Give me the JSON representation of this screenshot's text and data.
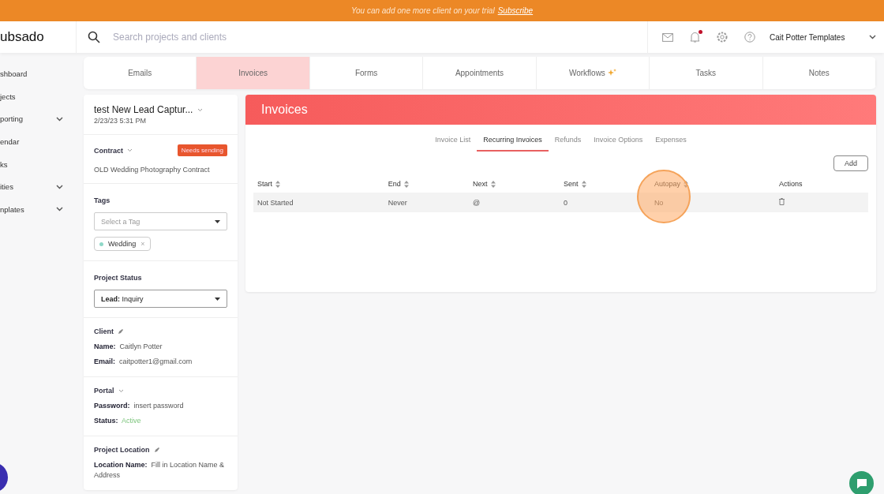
{
  "banner": {
    "text": "You can add one more client on your trial",
    "link": "Subscribe"
  },
  "header": {
    "logo": "ubsado",
    "search": {
      "placeholder": "Search projects and clients"
    },
    "notification_dot": true,
    "account": "Cait Potter Templates"
  },
  "sidebar": {
    "items": [
      {
        "label": "shboard",
        "expandable": false
      },
      {
        "label": "jects",
        "expandable": false
      },
      {
        "label": "porting",
        "expandable": true
      },
      {
        "label": "endar",
        "expandable": false
      },
      {
        "label": "ks",
        "expandable": false
      },
      {
        "label": "ities",
        "expandable": true
      },
      {
        "label": "nplates",
        "expandable": true
      }
    ]
  },
  "tabs": [
    {
      "label": "Emails",
      "selected": false,
      "sparkle": false
    },
    {
      "label": "Invoices",
      "selected": true,
      "sparkle": false
    },
    {
      "label": "Forms",
      "selected": false,
      "sparkle": false
    },
    {
      "label": "Appointments",
      "selected": false,
      "sparkle": false
    },
    {
      "label": "Workflows",
      "selected": false,
      "sparkle": true
    },
    {
      "label": "Tasks",
      "selected": false,
      "sparkle": false
    },
    {
      "label": "Notes",
      "selected": false,
      "sparkle": false
    }
  ],
  "project": {
    "title": "test New Lead Captur...",
    "date": "2/23/23 5:31 PM",
    "contract": {
      "heading": "Contract",
      "badge": "Needs sending",
      "name": "OLD Wedding Photography Contract"
    },
    "tags": {
      "heading": "Tags",
      "placeholder": "Select a Tag",
      "items": [
        {
          "label": "Wedding",
          "color": "#8fd8c8",
          "remove": "×"
        }
      ]
    },
    "status": {
      "heading": "Project Status",
      "label": "Lead:",
      "value": "Inquiry"
    },
    "client": {
      "heading": "Client",
      "fields": [
        {
          "label": "Name:",
          "value": "Caitlyn Potter"
        },
        {
          "label": "Email:",
          "value": "caitpotter1@gmail.com"
        }
      ]
    },
    "portal": {
      "heading": "Portal",
      "fields": [
        {
          "label": "Password:",
          "value": "insert password",
          "kind": "plain"
        },
        {
          "label": "Status:",
          "value": "Active",
          "kind": "status"
        }
      ]
    },
    "location": {
      "heading": "Project Location",
      "fields": [
        {
          "label": "Location Name:",
          "value": "Fill in Location Name & Address"
        }
      ]
    }
  },
  "invoices": {
    "title": "Invoices",
    "subtabs": [
      {
        "label": "Invoice List",
        "selected": false
      },
      {
        "label": "Recurring Invoices",
        "selected": true
      },
      {
        "label": "Refunds",
        "selected": false
      },
      {
        "label": "Invoice Options",
        "selected": false
      },
      {
        "label": "Expenses",
        "selected": false
      }
    ],
    "add_button": "Add",
    "table": {
      "columns": [
        {
          "label": "Start",
          "sortable": true
        },
        {
          "label": "End",
          "sortable": true
        },
        {
          "label": "Next",
          "sortable": true
        },
        {
          "label": "Sent",
          "sortable": true
        },
        {
          "label": "Autopay",
          "sortable": true
        },
        {
          "label": "Actions",
          "sortable": false
        }
      ],
      "rows": [
        [
          "Not Started",
          "Never",
          "@",
          "0",
          "No"
        ]
      ]
    }
  }
}
